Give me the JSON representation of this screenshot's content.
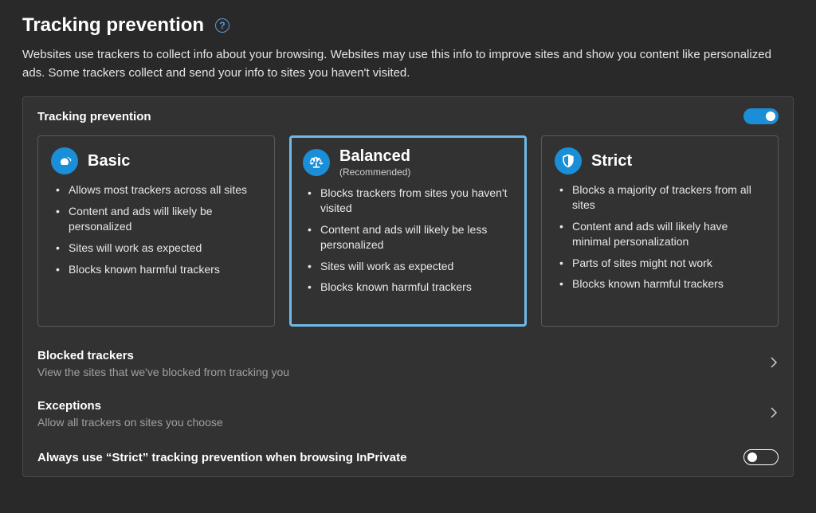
{
  "page": {
    "title": "Tracking prevention",
    "description": "Websites use trackers to collect info about your browsing. Websites may use this info to improve sites and show you content like personalized ads. Some trackers collect and send your info to sites you haven't visited."
  },
  "panel": {
    "title": "Tracking prevention",
    "master_toggle": true
  },
  "levels": {
    "selected": "balanced",
    "basic": {
      "title": "Basic",
      "subtitle": "",
      "bullets": [
        "Allows most trackers across all sites",
        "Content and ads will likely be personalized",
        "Sites will work as expected",
        "Blocks known harmful trackers"
      ]
    },
    "balanced": {
      "title": "Balanced",
      "subtitle": "(Recommended)",
      "bullets": [
        "Blocks trackers from sites you haven't visited",
        "Content and ads will likely be less personalized",
        "Sites will work as expected",
        "Blocks known harmful trackers"
      ]
    },
    "strict": {
      "title": "Strict",
      "subtitle": "",
      "bullets": [
        "Blocks a majority of trackers from all sites",
        "Content and ads will likely have minimal personalization",
        "Parts of sites might not work",
        "Blocks known harmful trackers"
      ]
    }
  },
  "rows": {
    "blocked": {
      "label": "Blocked trackers",
      "sublabel": "View the sites that we've blocked from tracking you"
    },
    "exceptions": {
      "label": "Exceptions",
      "sublabel": "Allow all trackers on sites you choose"
    },
    "inprivate": {
      "label": "Always use “Strict” tracking prevention when browsing InPrivate",
      "toggle": false
    }
  },
  "colors": {
    "accent": "#1a8ed6",
    "selected_border": "#6fb9e9",
    "background": "#292929",
    "panel": "#323232"
  }
}
